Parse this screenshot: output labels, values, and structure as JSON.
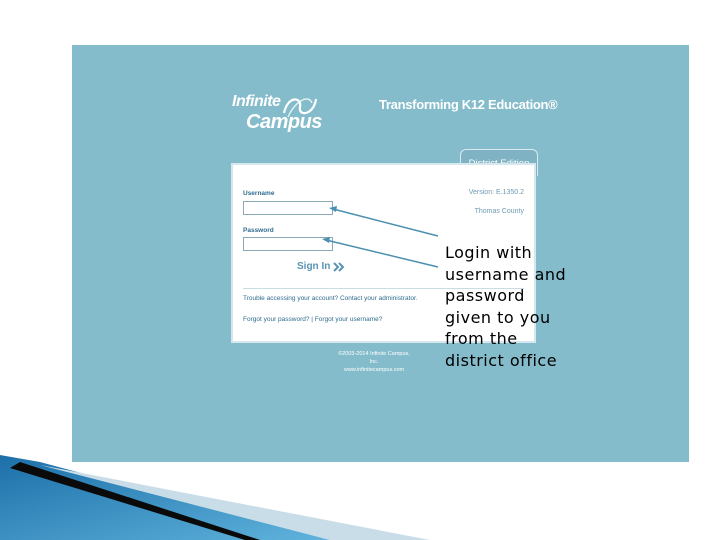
{
  "logo": {
    "line1": "Infinite",
    "line2": "Campus"
  },
  "tagline": "Transforming K12 Education®",
  "edition_tab": "District Edition",
  "login": {
    "version": "Version: E.1350.2",
    "district": "Thomas County",
    "username_label": "Username",
    "username_value": "",
    "password_label": "Password",
    "password_value": "",
    "signin_label": "Sign In",
    "trouble_text": "Trouble accessing your account? Contact your administrator.",
    "forgot_password": "Forgot your password?",
    "separator": "|",
    "forgot_username": "Forgot your username?"
  },
  "copyright": {
    "line1": "©2003-2014 Infinite Campus, Inc.",
    "line2": "www.infinitecampus.com"
  },
  "annotation": "Login with username and password given to you from the district office",
  "colors": {
    "screenshot_bg": "#84bccb",
    "arrow": "#4a8fb0",
    "annotation_text": "#000000"
  },
  "icons": {
    "logo_mark": "infinity-swoosh-icon",
    "signin": "double-chevron-right-icon"
  }
}
